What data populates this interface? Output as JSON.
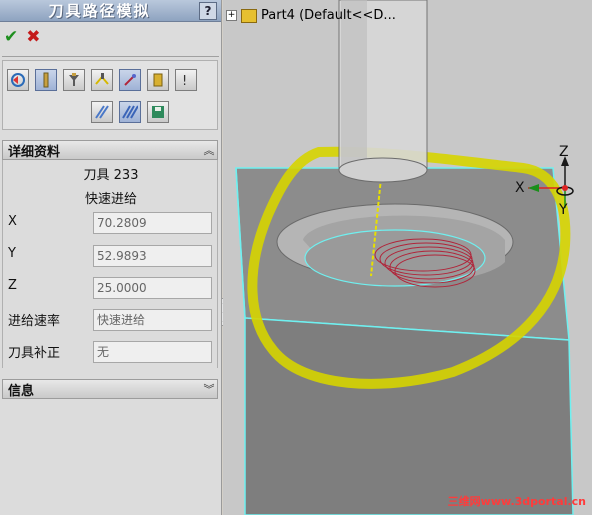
{
  "panel": {
    "title": "刀具路径模拟",
    "help": "?"
  },
  "details": {
    "header": "详细资料",
    "tool": "刀具 233",
    "mode": "快速进给",
    "rows": [
      {
        "label": "X",
        "value": "70.2809"
      },
      {
        "label": "Y",
        "value": "52.9893"
      },
      {
        "label": "Z",
        "value": "25.0000"
      },
      {
        "label": "进给速率",
        "value": "快速进给"
      },
      {
        "label": "刀具补正",
        "value": "无"
      }
    ]
  },
  "info": {
    "header": "信息"
  },
  "tree": {
    "part": "Part4  (Default<<D..."
  },
  "triad": {
    "x": "X",
    "y": "Y",
    "z": "Z"
  },
  "watermark": "三维网www.3dportal.cn",
  "colors": {
    "selection": "#d6d400",
    "edges": "#6ff0f0",
    "toolpath": "#b0253a"
  },
  "icons": {
    "ok": "check-icon",
    "cancel": "cross-icon"
  }
}
